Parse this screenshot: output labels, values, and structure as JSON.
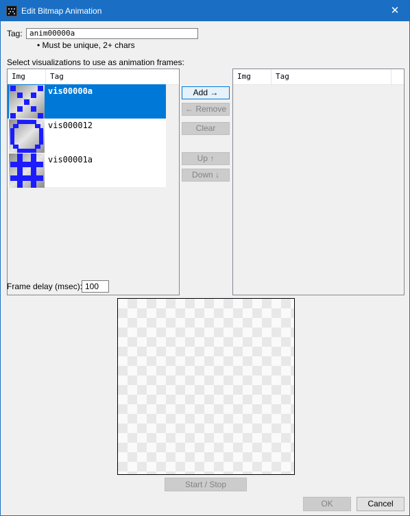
{
  "window": {
    "title": "Edit Bitmap Animation",
    "close_glyph": "✕",
    "accent_color": "#1a6fc4"
  },
  "tag": {
    "label": "Tag:",
    "value": "anim00000a",
    "hint": "• Must be unique, 2+ chars"
  },
  "select_label": "Select visualizations to use as animation frames:",
  "left_list": {
    "columns": [
      "Img",
      "Tag"
    ],
    "rows": [
      {
        "tag": "vis00000a",
        "icon": "x-pattern-bitmap-icon",
        "selected": true
      },
      {
        "tag": "vis000012",
        "icon": "circle-pattern-bitmap-icon",
        "selected": false
      },
      {
        "tag": "vis00001a",
        "icon": "hash-pattern-bitmap-icon",
        "selected": false
      }
    ]
  },
  "right_list": {
    "columns": [
      "Img",
      "Tag"
    ],
    "rows": []
  },
  "buttons": {
    "add": "Add →",
    "remove": "← Remove",
    "clear": "Clear",
    "up": "Up ↑",
    "down": "Down ↓",
    "start_stop": "Start / Stop",
    "ok": "OK",
    "cancel": "Cancel"
  },
  "frame_delay": {
    "label": "Frame delay (msec):",
    "value": "100"
  },
  "colors": {
    "selection": "#0078d7",
    "bitmap_pixel": "#1c1cff"
  }
}
